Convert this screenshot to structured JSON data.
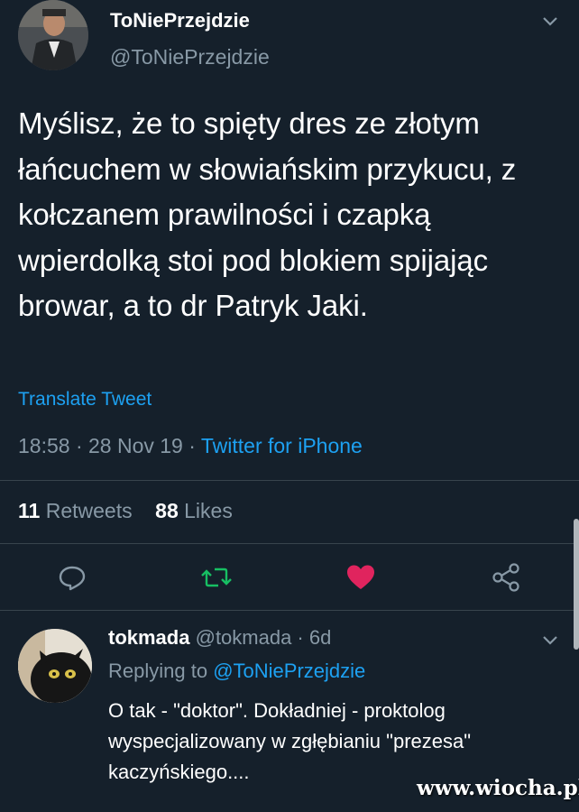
{
  "tweet": {
    "display_name": "ToNiePrzejdzie",
    "handle": "@ToNiePrzejdzie",
    "text": "Myślisz, że to spięty dres ze złotym łańcuchem w słowiańskim przykucu, z kołczanem prawilności i czapką wpierdolką stoi pod blokiem spijając browar, a to dr Patryk Jaki.",
    "translate_label": "Translate Tweet",
    "timestamp": "18:58 · 28 Nov 19 · ",
    "source": "Twitter for iPhone",
    "retweets_count": "11",
    "retweets_label": "Retweets",
    "likes_count": "88",
    "likes_label": "Likes",
    "liked": true
  },
  "reply": {
    "display_name": "tokmada",
    "handle_time": "@tokmada · 6d",
    "replying_prefix": "Replying to ",
    "replying_to": "@ToNiePrzejdzie",
    "text": "O tak - \"doktor\". Dokładniej - proktolog wyspecjalizowany w zgłębianiu \"prezesa\" kaczyńskiego...."
  },
  "watermark": "www.wiocha.pl",
  "colors": {
    "background": "#15202b",
    "accent": "#1da1f2",
    "secondary_text": "#8899a6",
    "retweet": "#17bf63",
    "like": "#e0245e"
  },
  "icons": [
    "chevron-down-icon",
    "reply-icon",
    "retweet-icon",
    "heart-icon",
    "share-icon"
  ]
}
